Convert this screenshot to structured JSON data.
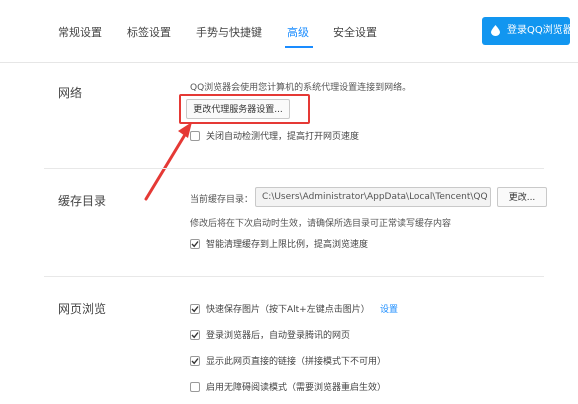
{
  "tabs": [
    {
      "label": "常规设置"
    },
    {
      "label": "标签设置"
    },
    {
      "label": "手势与快捷键"
    },
    {
      "label": "高级"
    },
    {
      "label": "安全设置"
    }
  ],
  "active_tab": "高级",
  "login_button": "登录QQ浏览器",
  "sections": {
    "network": {
      "title": "网络",
      "desc": "QQ浏览器会使用您计算机的系统代理设置连接到网络。",
      "proxy_button": "更改代理服务器设置...",
      "checkbox_label": "关闭自动检测代理，提高打开网页速度",
      "checkbox_checked": false
    },
    "cache": {
      "title": "缓存目录",
      "current_dir_label": "当前缓存目录：",
      "path_value": "C:\\Users\\Administrator\\AppData\\Local\\Tencent\\QQ",
      "change_button": "更改...",
      "note": "修改后将在下次启动时生效，请确保所选目录可正常读写缓存内容",
      "checkbox_label": "智能清理缓存到上限比例，提高浏览速度",
      "checkbox_checked": true
    },
    "browse": {
      "title": "网页浏览",
      "items": [
        {
          "label": "快速保存图片（按下Alt+左键点击图片）",
          "checked": true,
          "link": "设置"
        },
        {
          "label": "登录浏览器后，自动登录腾讯的网页",
          "checked": true
        },
        {
          "label": "显示此网页直接的链接（拼接模式下不可用）",
          "checked": true
        },
        {
          "label": "启用无障碍阅读模式（需要浏览器重启生效）",
          "checked": false
        }
      ]
    }
  },
  "colors": {
    "accent": "#1a8cff",
    "button_blue": "#1296f0",
    "annotation_red": "#e53935"
  }
}
